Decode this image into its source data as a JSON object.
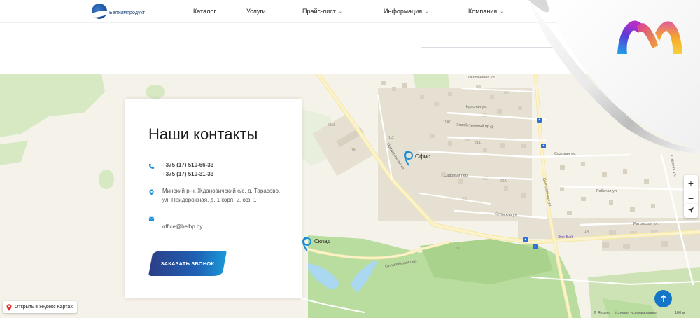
{
  "header": {
    "logo_text": "Белхимпродукт",
    "nav": [
      {
        "label": "Каталог",
        "has_dropdown": false
      },
      {
        "label": "Услуги",
        "has_dropdown": false
      },
      {
        "label": "Прайс-лист",
        "has_dropdown": true
      },
      {
        "label": "Информация",
        "has_dropdown": true
      },
      {
        "label": "Компания",
        "has_dropdown": true
      }
    ]
  },
  "contacts": {
    "title": "Наши контакты",
    "phone_1": "+375 (17) 510-66-33",
    "phone_2": "+375 (17) 510-31-33",
    "address_line_1": "Минский р-н, Ждановичский с/с, д. Тарасово,",
    "address_line_2": "ул. Придорожная, д. 1 корп. 2, оф. 1",
    "email": "office@belhp.by",
    "call_button": "Заказать звонок"
  },
  "map": {
    "pin_office": "Офис",
    "pin_warehouse": "Склад",
    "streets": {
      "kashtanovaya": "Каштановая ул.",
      "krasnaya": "Красная ул.",
      "khozyaystvenny": "Хозяйственный пр-д",
      "pridorozhnaya": "Придорожная ул.",
      "sadovy_per": "Садовый пер.",
      "sadovaya": "Садовая ул.",
      "rabochaya": "Рабочая ул.",
      "selskaya": "Сельская ул.",
      "ratomskaya": "Ратомская ул.",
      "tsentralnaya": "Центральная ул.",
      "olimpiyskiy": "Олимпийский пер.",
      "ozyornaya": "Озёрная ул.",
      "shop": "Эвё Бай"
    },
    "open_in_yandex": "Открыть в Яндекс Картах",
    "copyright_brand": "© Яндекс",
    "terms": "Условия использования",
    "scale": "100 м",
    "zoom_in": "+",
    "zoom_out": "−"
  },
  "colors": {
    "accent": "#1b8fd8",
    "button_from": "#2c3e86",
    "button_to": "#1a9ad9",
    "scroll_up": "#1576c7"
  },
  "icons": {
    "phone": "phone-icon",
    "location": "location-pin-icon",
    "mail": "mail-icon",
    "scroll_up": "arrow-up-icon",
    "geolocation": "geolocation-icon"
  }
}
